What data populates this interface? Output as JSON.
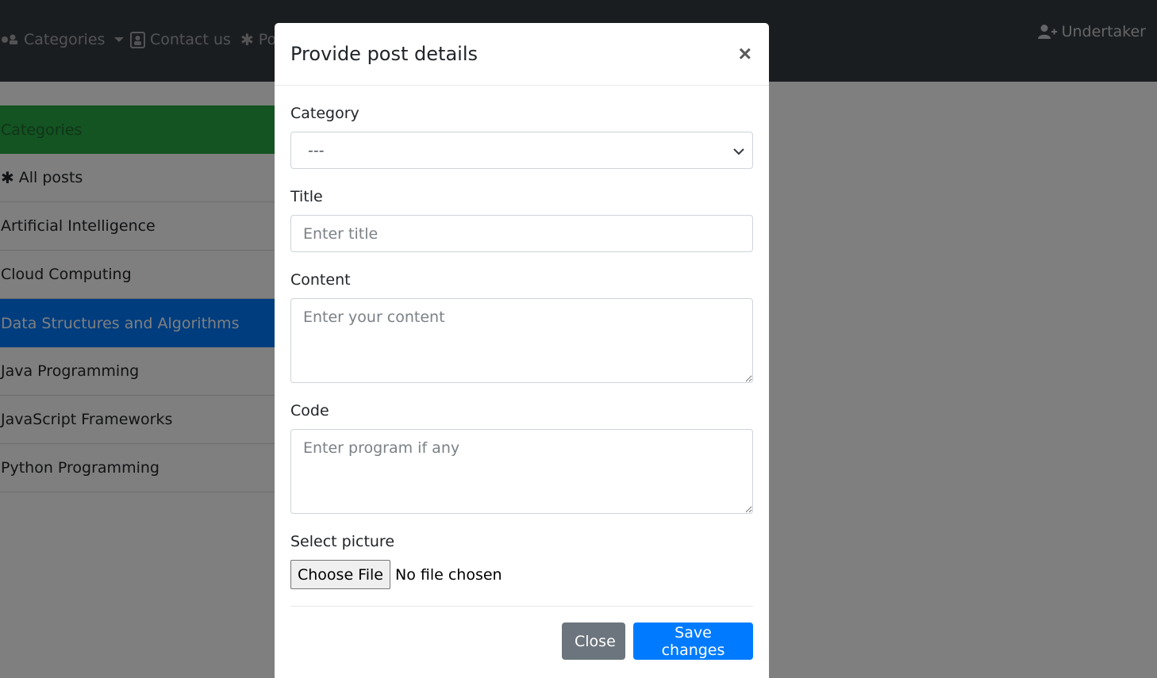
{
  "navbar": {
    "categories_label": "Categories",
    "contact_label": "Contact us",
    "posts_label": "Po",
    "user_label": "Undertaker"
  },
  "sidebar": {
    "header": "Categories",
    "items": [
      {
        "label": "All posts",
        "icon": "asterisk-icon"
      },
      {
        "label": "Artificial Intelligence"
      },
      {
        "label": "Cloud Computing"
      },
      {
        "label": "Data Structures and Algorithms",
        "active": true
      },
      {
        "label": "Java Programming"
      },
      {
        "label": "JavaScript Frameworks"
      },
      {
        "label": "Python Programming"
      }
    ]
  },
  "modal": {
    "title": "Provide post details",
    "close_symbol": "×",
    "category": {
      "label": "Category",
      "selected": "---"
    },
    "title_field": {
      "label": "Title",
      "placeholder": "Enter title"
    },
    "content_field": {
      "label": "Content",
      "placeholder": "Enter your content"
    },
    "code_field": {
      "label": "Code",
      "placeholder": "Enter program if any"
    },
    "picture": {
      "label": "Select picture",
      "button": "Choose File",
      "status": "No file chosen"
    },
    "close_button": "Close",
    "save_button": "Save changes"
  },
  "colors": {
    "navbar": "#343a40",
    "category_header": "#28a745",
    "active_item": "#007bff",
    "close_button": "#6c757d",
    "save_button": "#007bff"
  }
}
